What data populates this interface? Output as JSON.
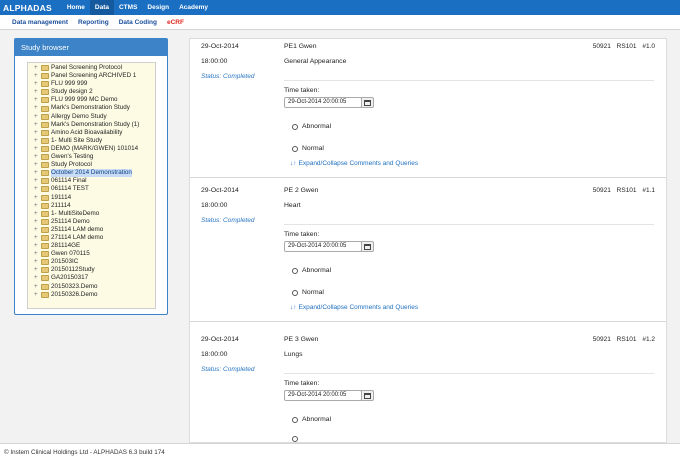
{
  "app": {
    "logo": "ALPHADAS"
  },
  "topnav": [
    {
      "label": "Home",
      "active": false
    },
    {
      "label": "Data",
      "active": true
    },
    {
      "label": "CTMS",
      "active": false
    },
    {
      "label": "Design",
      "active": false
    },
    {
      "label": "Academy",
      "active": false
    }
  ],
  "subnav": [
    {
      "label": "Data management"
    },
    {
      "label": "Reporting"
    },
    {
      "label": "Data Coding"
    },
    {
      "label": "eCRF"
    }
  ],
  "browser": {
    "title": "Study browser",
    "items": [
      "Panel Screening Protocol",
      "Panel Screening ARCHIVED 1",
      "FLU 999 999",
      "Study design 2",
      "FLU 999 999 MC Demo",
      "Mark's Demonstration Study",
      "Allergy Demo Study",
      "Mark's Demonstration Study (1)",
      "Amino Acid Bioavailability",
      "1- Multi Site Study",
      "DEMO (MARK/GWEN) 101014",
      "Gwen's Testing",
      "Study Protocol",
      "October 2014 Demonstration",
      "061114 Final",
      "061114 TEST",
      "191114",
      "211114",
      "1- MultiSiteDemo",
      "251114 Demo",
      "251114 LAM demo",
      "271114 LAM demo",
      "281114GE",
      "Gwen 070115",
      "201503IC",
      "20150112Study",
      "GA20150317",
      "20150323.Demo",
      "20150326.Demo"
    ],
    "selected_index": 13
  },
  "records": [
    {
      "date": "29-Oct-2014",
      "time": "18:00:00",
      "status": "Status: Completed",
      "title": "PE1 Gwen",
      "subtitle": "General Appearance",
      "code": "50921 RS101 #1.0",
      "time_taken_label": "Time taken:",
      "time_taken_value": "29-Oct-2014 20:00:05",
      "option_abnormal": "Abnormal",
      "option_normal": "Normal",
      "expand_label": "Expand/Collapse Comments and Queries"
    },
    {
      "date": "29-Oct-2014",
      "time": "18:00:00",
      "status": "Status: Completed",
      "title": "PE 2 Gwen",
      "subtitle": "Heart",
      "code": "50921 RS101 #1.1",
      "time_taken_label": "Time taken:",
      "time_taken_value": "29-Oct-2014 20:00:05",
      "option_abnormal": "Abnormal",
      "option_normal": "Normal",
      "expand_label": "Expand/Collapse Comments and Queries"
    },
    {
      "date": "29-Oct-2014",
      "time": "18:00:00",
      "status": "Status: Completed",
      "title": "PE 3 Gwen",
      "subtitle": "Lungs",
      "code": "50921 RS101 #1.2",
      "time_taken_label": "Time taken:",
      "time_taken_value": "29-Oct-2014 20:00:05",
      "option_abnormal": "Abnormal",
      "option_normal": "",
      "expand_label": ""
    }
  ],
  "footer": {
    "text": "© Instem Clinical Holdings Ltd - ALPHADAS 6.3 build 174"
  }
}
